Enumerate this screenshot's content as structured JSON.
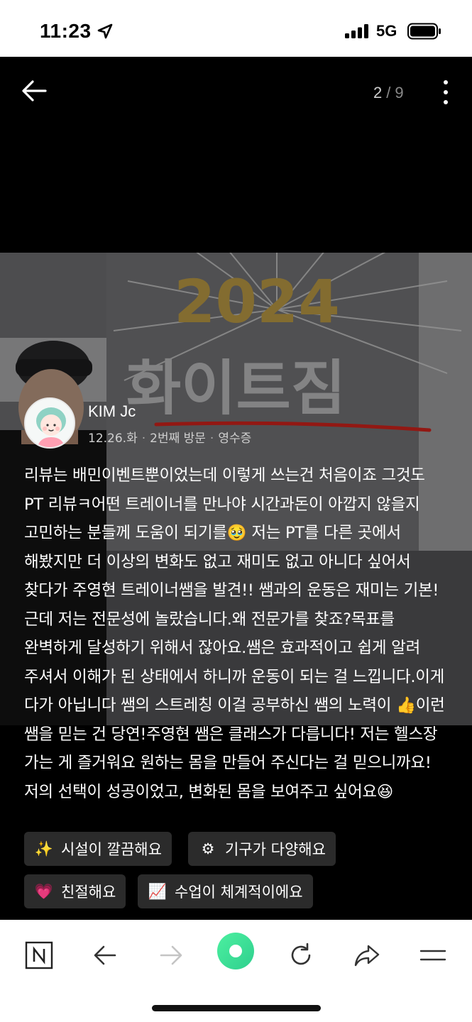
{
  "status_bar": {
    "time": "11:23",
    "network": "5G"
  },
  "viewer": {
    "current_index": "2",
    "separator": "/",
    "total": "9"
  },
  "photo": {
    "sign_year": "2024",
    "sign_text": "화이트짐"
  },
  "review": {
    "author": "KIM Jc",
    "date": "12.26.화",
    "visit": "2번째 방문",
    "proof": "영수증",
    "text": "리뷰는 배민이벤트뿐이었는데 이렇게 쓰는건 처음이죠 그것도 PT 리뷰ㅋ어떤 트레이너를 만나야 시간과돈이 아깝지 않을지 고민하는 분들께 도움이 되기를🥹 저는 PT를 다른 곳에서 해봤지만 더 이상의 변화도 없고 재미도 없고 아니다 싶어서 찾다가 주영현 트레이너쌤을 발견!! 쌤과의 운동은 재미는 기본! 근데 저는 전문성에 놀랐습니다.왜 전문가를 찾죠?목표를 완벽하게 달성하기 위해서 잖아요.쌤은 효과적이고 쉽게 알려 주셔서 이해가 된 상태에서 하니까 운동이 되는 걸 느낍니다.이게 다가 아닙니다 쌤의 스트레칭 이걸 공부하신 쌤의 노력이 👍이런 쌤을 믿는 건 당연!주영현 쌤은 클래스가 다릅니다! 저는 헬스장 가는 게 즐거워요 원하는 몸을 만들어 주신다는 걸 믿으니까요! 저의 선택이 성공이었고, 변화된 몸을 보여주고 싶어요😆"
  },
  "tags": [
    {
      "emoji": "✨",
      "label": "시설이 깔끔해요"
    },
    {
      "emoji": "⚙",
      "label": "기구가 다양해요"
    },
    {
      "emoji": "💗",
      "label": "친절해요"
    },
    {
      "emoji": "📈",
      "label": "수업이 체계적이에요"
    }
  ],
  "toolbar": {
    "items": [
      "naver-home",
      "back",
      "forward",
      "green-dot",
      "refresh",
      "share",
      "menu"
    ]
  },
  "colors": {
    "accent_green": "#3ee28b",
    "tag_bg": "#2b2b2b",
    "underline_red": "#e0261e",
    "gold": "#c9a227"
  }
}
